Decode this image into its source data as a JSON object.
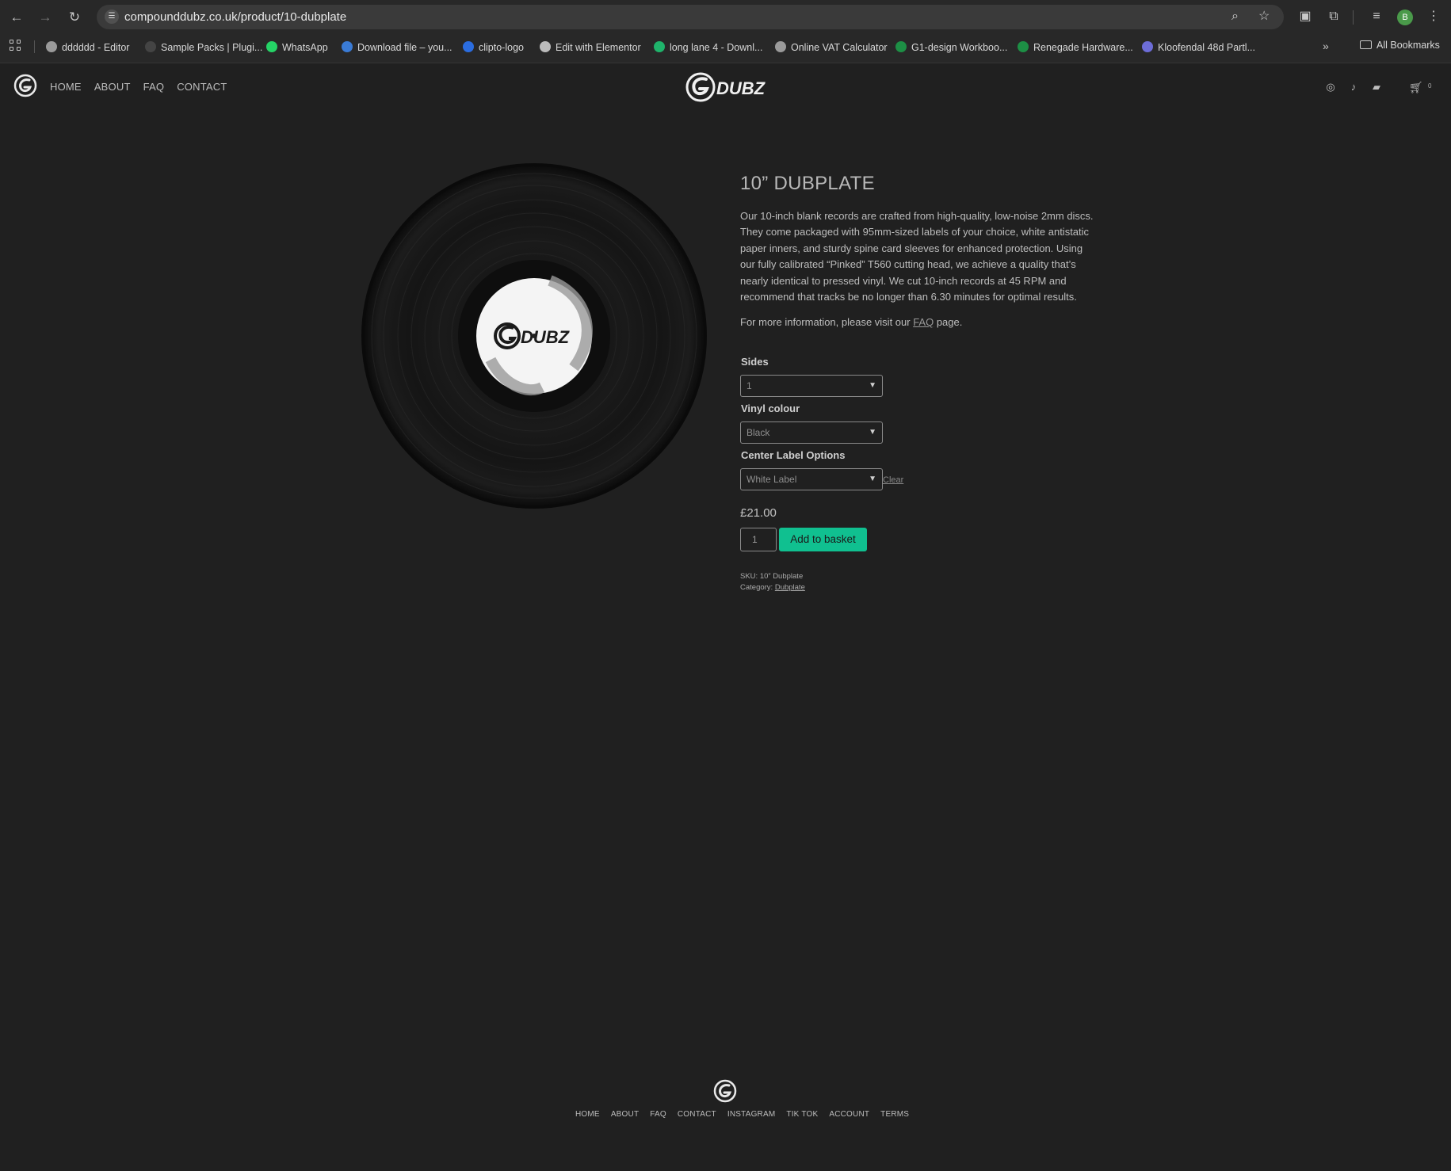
{
  "browser": {
    "url": "compounddubz.co.uk/product/10-dubplate",
    "profile_initial": "B",
    "bookmarks": [
      {
        "label": "dddddd - Editor",
        "color": "#9a9a9a"
      },
      {
        "label": "Sample Packs | Plugi...",
        "color": "#444444"
      },
      {
        "label": "WhatsApp",
        "color": "#25d366"
      },
      {
        "label": "Download file – you...",
        "color": "#3a7bd5"
      },
      {
        "label": "clipto-logo",
        "color": "#2b6de0"
      },
      {
        "label": "Edit with Elementor",
        "color": "#bbbbbb"
      },
      {
        "label": "long lane 4 - Downl...",
        "color": "#1fb36b"
      },
      {
        "label": "Online VAT Calculator",
        "color": "#9a9a9a"
      },
      {
        "label": "G1-design Workboo...",
        "color": "#1d8f45"
      },
      {
        "label": "Renegade Hardware...",
        "color": "#1d8f45"
      },
      {
        "label": "Kloofendal 48d Partl...",
        "color": "#6d6dd8"
      }
    ],
    "all_bookmarks": "All Bookmarks"
  },
  "site": {
    "nav": [
      "HOME",
      "ABOUT",
      "FAQ",
      "CONTACT"
    ],
    "cart_count": "0"
  },
  "product": {
    "title": "10” DUBPLATE",
    "description": "Our 10-inch blank records are crafted from high-quality, low-noise 2mm discs. They come packaged with 95mm-sized labels of your choice, white antistatic paper inners, and sturdy spine card sleeves for enhanced protection. Using our fully calibrated “Pinked” T560 cutting head, we achieve a quality that’s nearly identical to pressed vinyl. We cut 10-inch records at 45 RPM and recommend that tracks be no longer than 6.30 minutes for optimal results.",
    "more_prefix": "For more information, please visit our ",
    "more_link": "FAQ",
    "more_suffix": " page.",
    "label_logo_text": "DUBZ",
    "options": {
      "sides_label": "Sides",
      "sides_value": "1",
      "vinyl_label": "Vinyl colour",
      "vinyl_value": "Black",
      "center_label": "Center Label Options",
      "center_value": "White Label",
      "clear": "Clear"
    },
    "price": "£21.00",
    "quantity": "1",
    "add_to_basket": "Add to basket",
    "sku_label": "SKU:",
    "sku_value": "10” Dubplate",
    "category_label": "Category:",
    "category_value": "Dubplate",
    "accent_color": "#10c090"
  },
  "footer": {
    "nav": [
      "HOME",
      "ABOUT",
      "FAQ",
      "CONTACT",
      "INSTAGRAM",
      "TIK TOK",
      "ACCOUNT",
      "TERMS"
    ]
  }
}
